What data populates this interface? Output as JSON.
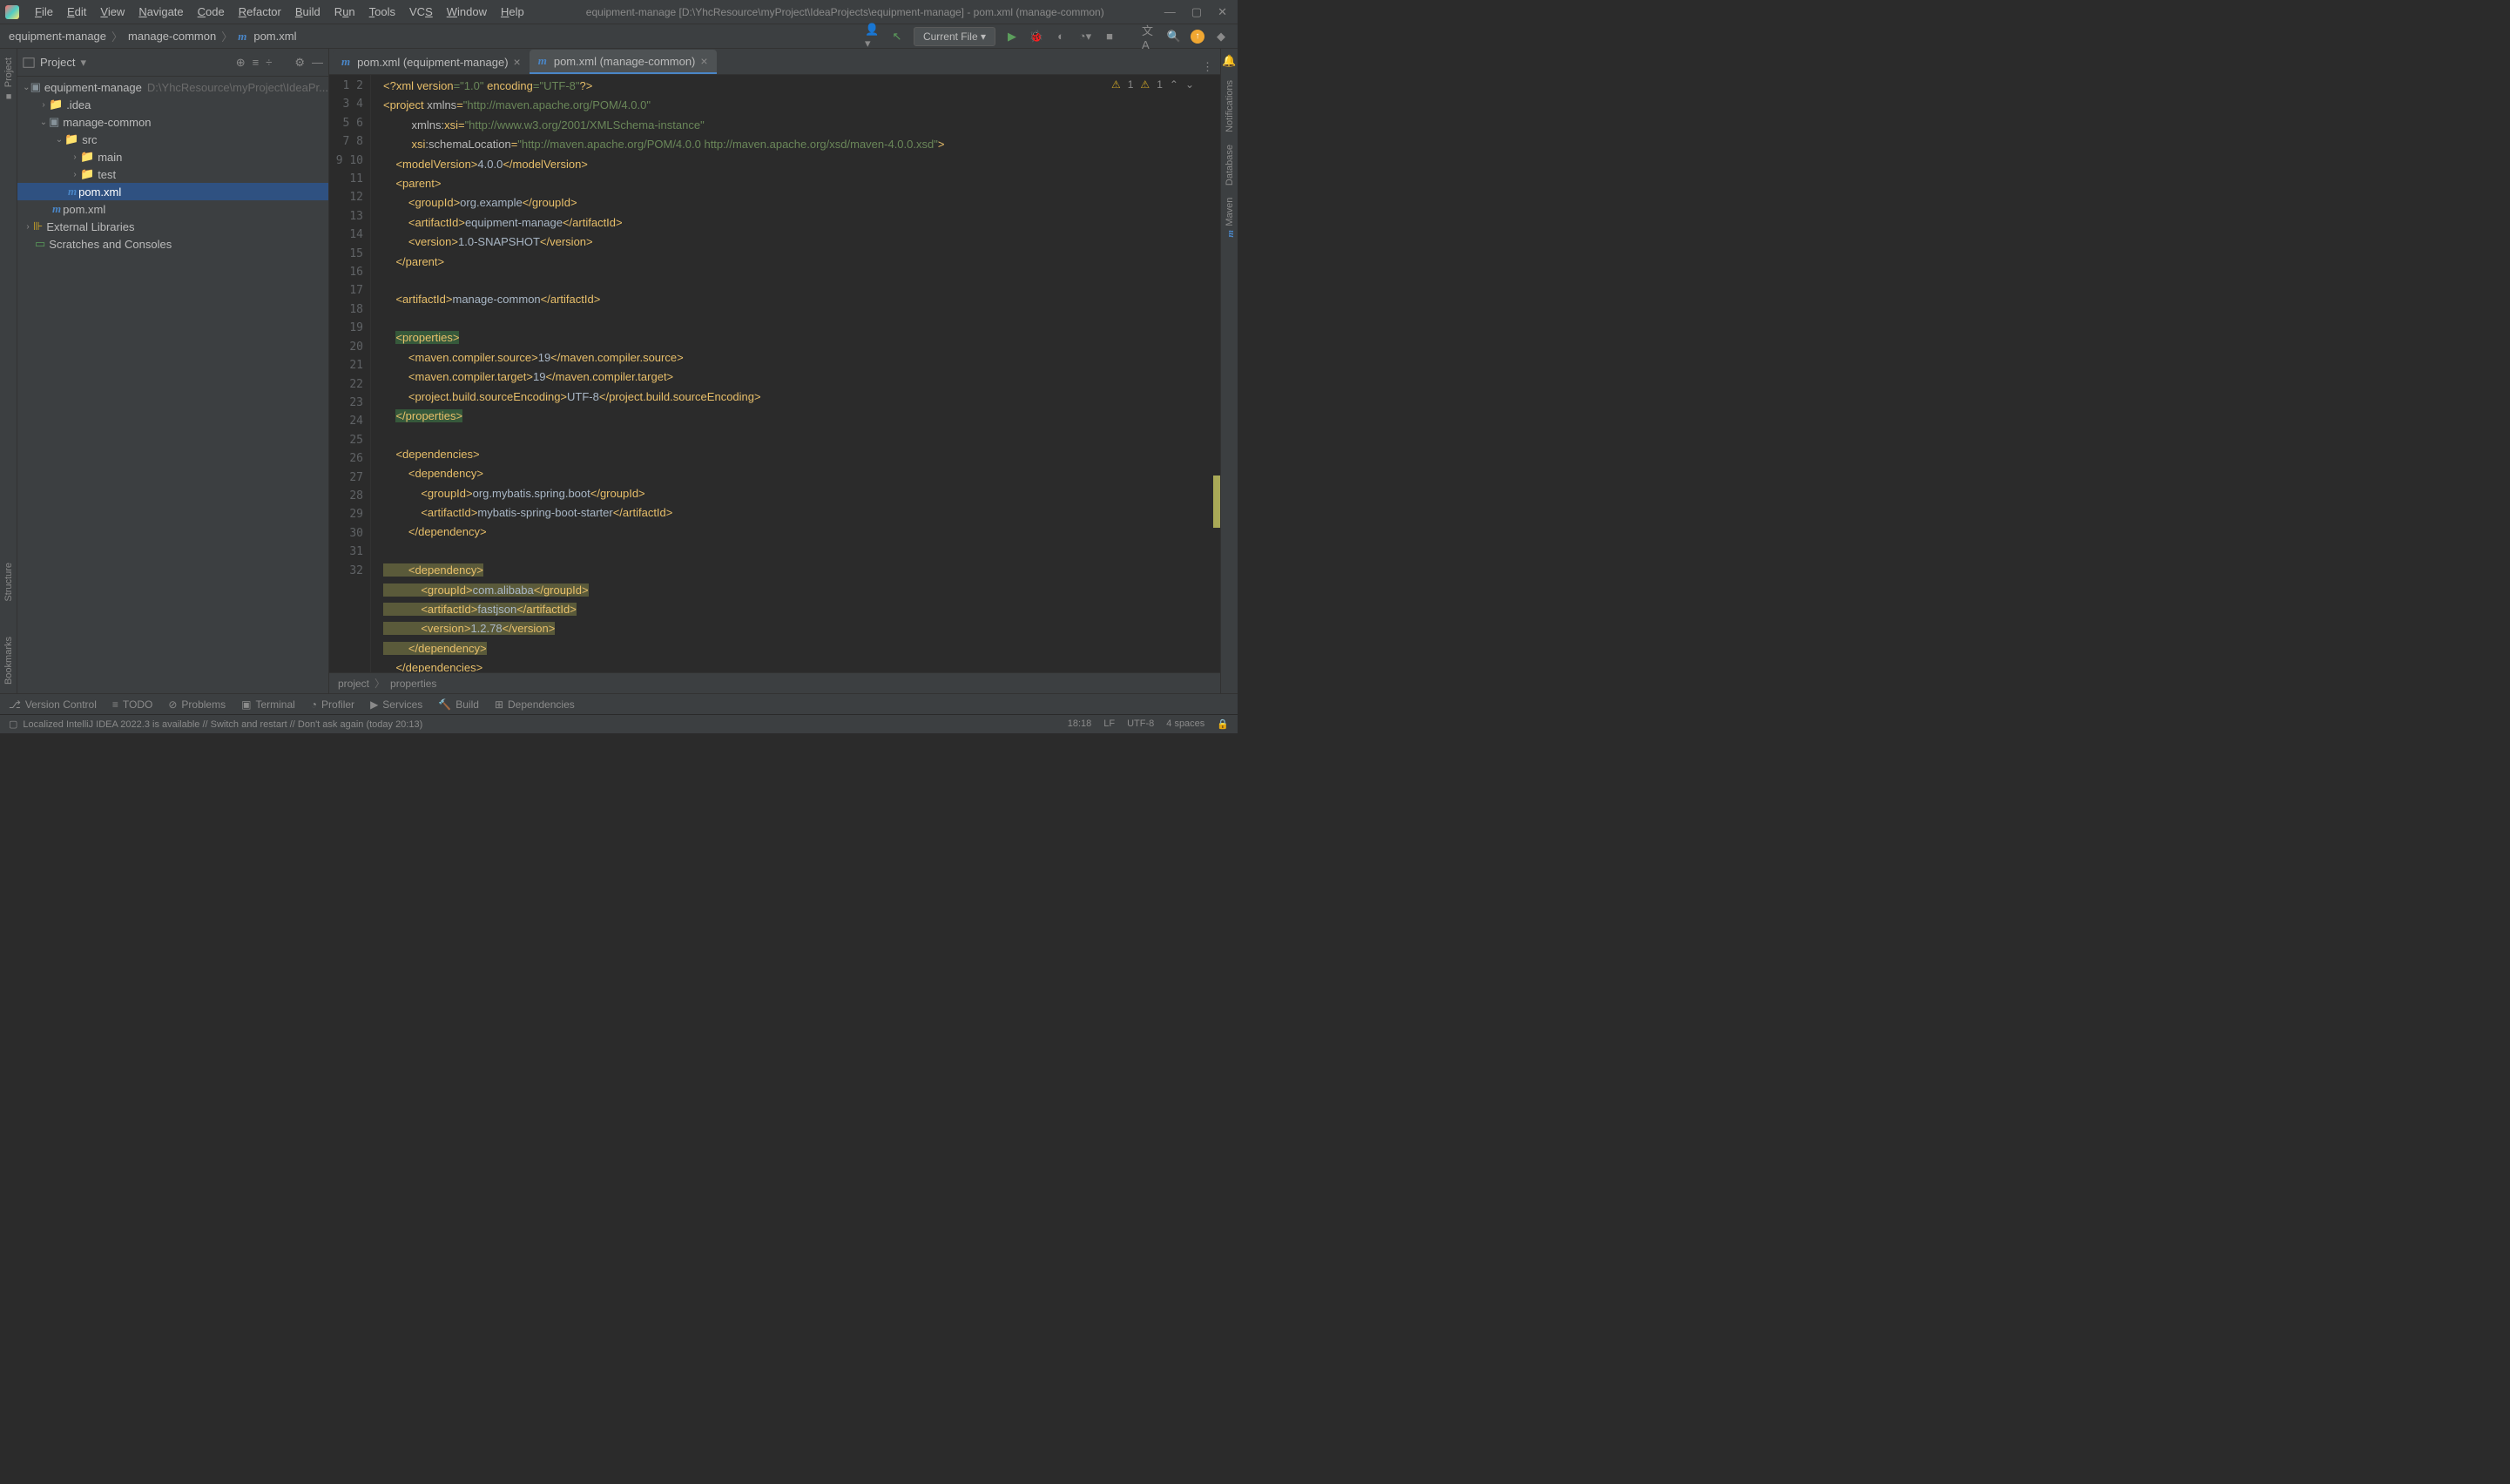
{
  "title": "equipment-manage [D:\\YhcResource\\myProject\\IdeaProjects\\equipment-manage] - pom.xml (manage-common)",
  "menu": [
    "File",
    "Edit",
    "View",
    "Navigate",
    "Code",
    "Refactor",
    "Build",
    "Run",
    "Tools",
    "VCS",
    "Window",
    "Help"
  ],
  "breadcrumb": {
    "p1": "equipment-manage",
    "p2": "manage-common",
    "p3": "pom.xml"
  },
  "run_config": "Current File",
  "sidebar": {
    "title": "Project",
    "root": {
      "name": "equipment-manage",
      "path": "D:\\YhcResource\\myProject\\IdeaPr..."
    },
    "items": {
      "idea": ".idea",
      "mc": "manage-common",
      "src": "src",
      "main": "main",
      "test": "test",
      "pom1": "pom.xml",
      "pom2": "pom.xml",
      "ext": "External Libraries",
      "scratch": "Scratches and Consoles"
    }
  },
  "tabs": [
    {
      "label": "pom.xml (equipment-manage)"
    },
    {
      "label": "pom.xml (manage-common)"
    }
  ],
  "warnings": {
    "w1": "1",
    "w2": "1"
  },
  "code": {
    "l1a": "<?",
    "l1b": "xml version",
    "l1c": "=\"1.0\" ",
    "l1d": "encoding",
    "l1e": "=\"UTF-8\"",
    "l1f": "?>",
    "l2a": "<project ",
    "l2b": "xmlns",
    "l2c": "=",
    "l2s": "\"http://maven.apache.org/POM/4.0.0\"",
    "l3a": "         ",
    "l3b": "xmlns:",
    "l3c": "xsi",
    "l3d": "=",
    "l3s": "\"http://www.w3.org/2001/XMLSchema-instance\"",
    "l4a": "         ",
    "l4b": "xsi",
    "l4c": ":schemaLocation",
    "l4d": "=",
    "l4s": "\"http://maven.apache.org/POM/4.0.0 http://maven.apache.org/xsd/maven-4.0.0.xsd\"",
    "l4e": ">",
    "l5a": "    <modelVersion>",
    "l5b": "4.0.0",
    "l5c": "</modelVersion>",
    "l6a": "    <parent>",
    "l7a": "        <groupId>",
    "l7b": "org.example",
    "l7c": "</groupId>",
    "l8a": "        <artifactId>",
    "l8b": "equipment-manage",
    "l8c": "</artifactId>",
    "l9a": "        <version>",
    "l9b": "1.0-SNAPSHOT",
    "l9c": "</version>",
    "l10a": "    </parent>",
    "l12a": "    <artifactId>",
    "l12b": "manage-common",
    "l12c": "</artifactId>",
    "l14a": "    ",
    "l14b": "<properties>",
    "l15a": "        <maven.compiler.source>",
    "l15b": "19",
    "l15c": "</maven.compiler.source>",
    "l16a": "        <maven.compiler.target>",
    "l16b": "19",
    "l16c": "</maven.compiler.target>",
    "l17a": "        <project.build.sourceEncoding>",
    "l17b": "UTF-8",
    "l17c": "</project.build.sourceEncoding>",
    "l18a": "    ",
    "l18b": "</properties>",
    "l20a": "    <dependencies>",
    "l21a": "        <dependency>",
    "l22a": "            <groupId>",
    "l22b": "org.mybatis.spring.boot",
    "l22c": "</groupId>",
    "l23a": "            <artifactId>",
    "l23b": "mybatis-spring-boot-starter",
    "l23c": "</artifactId>",
    "l24a": "        </dependency>",
    "l26a": "        ",
    "l26b": "<dependency>",
    "l27a": "            <groupId>",
    "l27b": "com.alibaba",
    "l27c": "</groupId>",
    "l28a": "            <artifactId>",
    "l28b": "fastjson",
    "l28c": "</artifactId>",
    "l29a": "            <version>",
    "l29b": "1.2.78",
    "l29c": "</version>",
    "l30a": "        ",
    "l30b": "</dependency>",
    "l31a": "    </dependencies>"
  },
  "editor_bc": {
    "p1": "project",
    "p2": "properties"
  },
  "bottom": {
    "vc": "Version Control",
    "todo": "TODO",
    "problems": "Problems",
    "profiler": "Profiler",
    "services": "Services",
    "build": "Build",
    "terminal": "Terminal",
    "deps": "Dependencies"
  },
  "right_tools": {
    "notif": "Notifications",
    "db": "Database",
    "maven": "Maven"
  },
  "left_tools": {
    "project": "Project",
    "structure": "Structure",
    "bookmarks": "Bookmarks"
  },
  "status": {
    "msg": "Localized IntelliJ IDEA 2022.3 is available // Switch and restart // Don't ask again (today 20:13)",
    "pos": "18:18",
    "lf": "LF",
    "enc": "UTF-8",
    "indent": "4 spaces"
  }
}
